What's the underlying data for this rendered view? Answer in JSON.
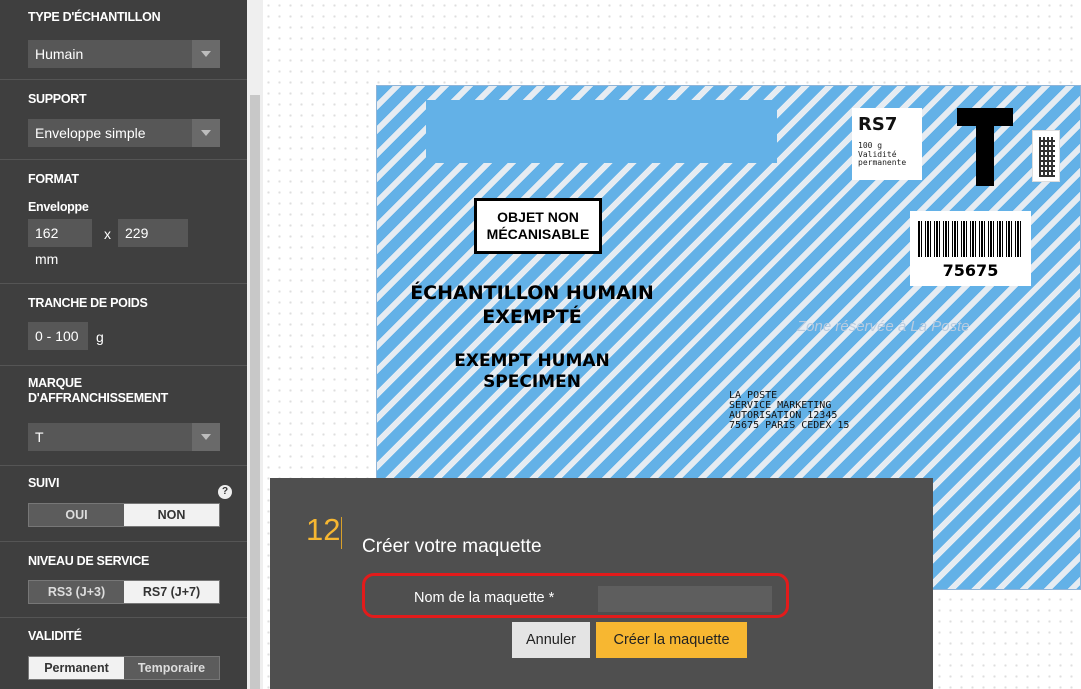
{
  "sidebar": {
    "sample_type": {
      "title": "TYPE D'ÉCHANTILLON",
      "value": "Humain"
    },
    "support": {
      "title": "SUPPORT",
      "value": "Enveloppe simple"
    },
    "format": {
      "title": "FORMAT",
      "subtitle": "Enveloppe",
      "width": "162",
      "sep": "x",
      "height": "229",
      "unit": "mm"
    },
    "weight": {
      "title": "TRANCHE DE POIDS",
      "value": "0 - 100",
      "unit": "g"
    },
    "franking": {
      "title": "MARQUE D'AFFRANCHISSEMENT",
      "value": "T"
    },
    "tracking": {
      "title": "SUIVI",
      "help": "?",
      "options": [
        "OUI",
        "NON"
      ],
      "selected": "NON"
    },
    "service": {
      "title": "NIVEAU DE SERVICE",
      "options": [
        "RS3 (J+3)",
        "RS7 (J+7)"
      ],
      "selected": "RS7 (J+7)"
    },
    "validity": {
      "title": "VALIDITÉ",
      "options": [
        "Permanent",
        "Temporaire"
      ],
      "selected": "Permanent"
    }
  },
  "envelope": {
    "rs7": "RS7",
    "rs7_small": "100 g\nValidité\npermanente",
    "barcode_number": "75675",
    "objet_line1": "OBJET NON",
    "objet_line2": "MÉCANISABLE",
    "fr_line1": "ÉCHANTILLON HUMAIN",
    "fr_line2": "EXEMPTÉ",
    "en_line1": "EXEMPT HUMAN",
    "en_line2": "SPECIMEN",
    "zone": "Zone réservée à La Poste",
    "address": "LA POSTE\nSERVICE MARKETING\nAUTORISATION 12345\n75675 PARIS CEDEX 15",
    "colors": {
      "stripe_blue": "#63b1e7",
      "stripe_light": "#e6ecf2"
    }
  },
  "dialog": {
    "step": "12",
    "title": "Créer votre maquette",
    "name_label": "Nom de la maquette *",
    "name_value": "",
    "cancel": "Annuler",
    "create": "Créer la maquette",
    "colors": {
      "accent": "#f7b731",
      "highlight": "#e31b1b"
    }
  }
}
